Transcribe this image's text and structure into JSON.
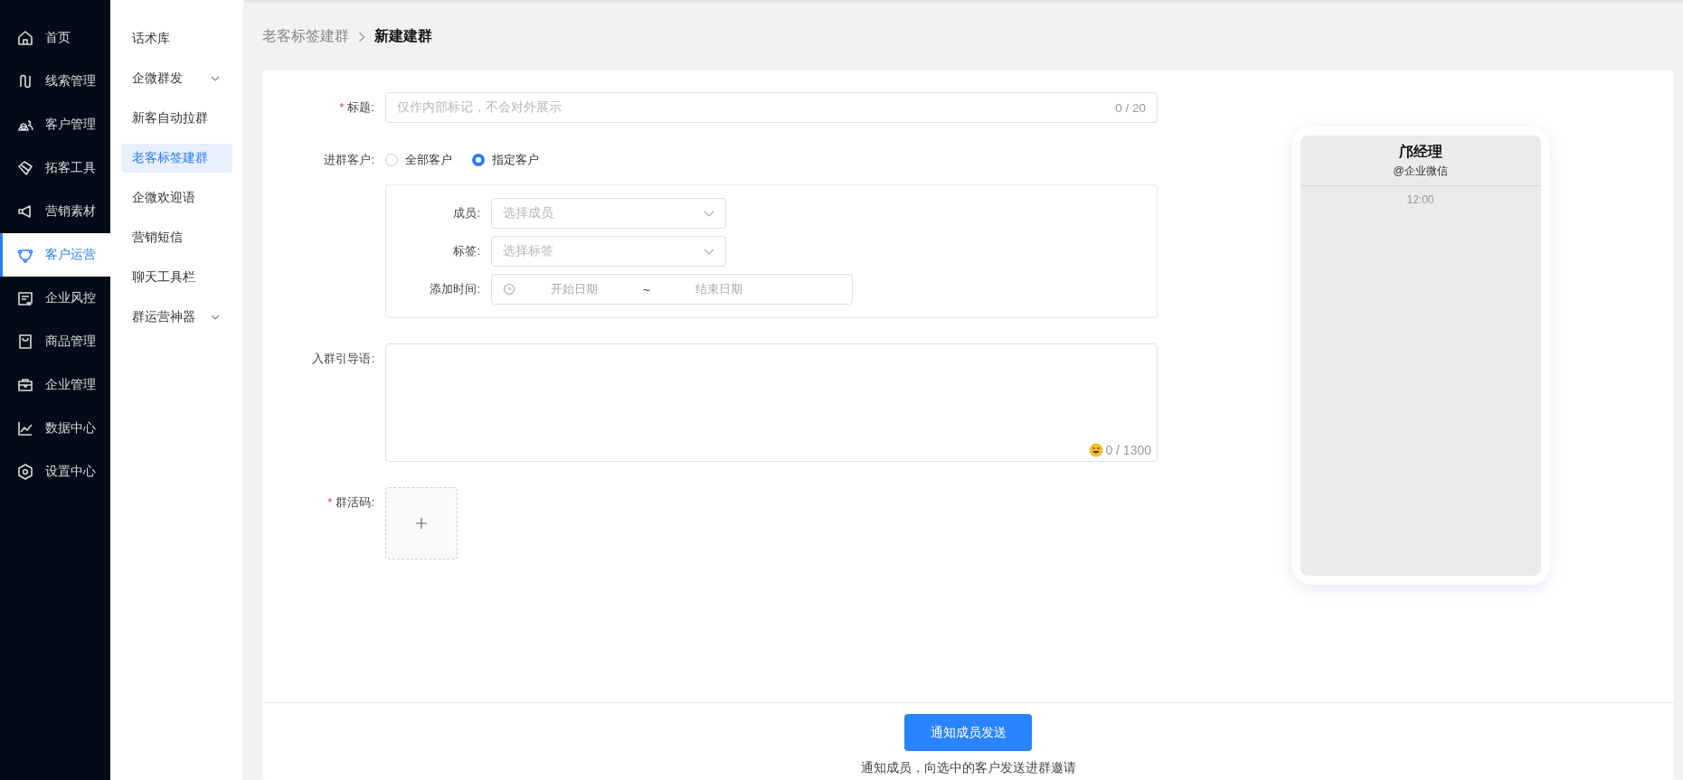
{
  "sidebar": {
    "items": [
      {
        "label": "首页",
        "selected": false
      },
      {
        "label": "线索管理",
        "selected": false
      },
      {
        "label": "客户管理",
        "selected": false
      },
      {
        "label": "拓客工具",
        "selected": false
      },
      {
        "label": "营销素材",
        "selected": false
      },
      {
        "label": "客户运营",
        "selected": true
      },
      {
        "label": "企业风控",
        "selected": false
      },
      {
        "label": "商品管理",
        "selected": false
      },
      {
        "label": "企业管理",
        "selected": false
      },
      {
        "label": "数据中心",
        "selected": false
      },
      {
        "label": "设置中心",
        "selected": false
      }
    ]
  },
  "submenu": {
    "items": [
      {
        "label": "话术库",
        "selected": false,
        "has_children": false
      },
      {
        "label": "企微群发",
        "selected": false,
        "has_children": true
      },
      {
        "label": "新客自动拉群",
        "selected": false,
        "has_children": false
      },
      {
        "label": "老客标签建群",
        "selected": true,
        "has_children": false
      },
      {
        "label": "企微欢迎语",
        "selected": false,
        "has_children": false
      },
      {
        "label": "营销短信",
        "selected": false,
        "has_children": false
      },
      {
        "label": "聊天工具栏",
        "selected": false,
        "has_children": false
      },
      {
        "label": "群运营神器",
        "selected": false,
        "has_children": true
      }
    ]
  },
  "breadcrumb": {
    "parent": "老客标签建群",
    "current": "新建建群"
  },
  "form": {
    "title": {
      "label": "标题:",
      "required_mark": "*",
      "placeholder": "仅作内部标记，不会对外展示",
      "counter": "0 / 20"
    },
    "customers": {
      "label": "进群客户:",
      "options": [
        {
          "label": "全部客户",
          "selected": false
        },
        {
          "label": "指定客户",
          "selected": true
        }
      ]
    },
    "filters": {
      "member": {
        "label": "成员:",
        "placeholder": "选择成员"
      },
      "tag": {
        "label": "标签:",
        "placeholder": "选择标签"
      },
      "date": {
        "label": "添加时间:",
        "start_placeholder": "开始日期",
        "separator": "~",
        "end_placeholder": "结束日期"
      }
    },
    "intro": {
      "label": "入群引导语:",
      "counter": "0 / 1300"
    },
    "qrcode": {
      "label": "群活码:",
      "required_mark": "*"
    }
  },
  "footer": {
    "button": "通知成员发送",
    "hint": "通知成员，向选中的客户发送进群邀请"
  },
  "preview": {
    "name": "邝经理",
    "subtitle": "@企业微信",
    "time": "12:00"
  }
}
